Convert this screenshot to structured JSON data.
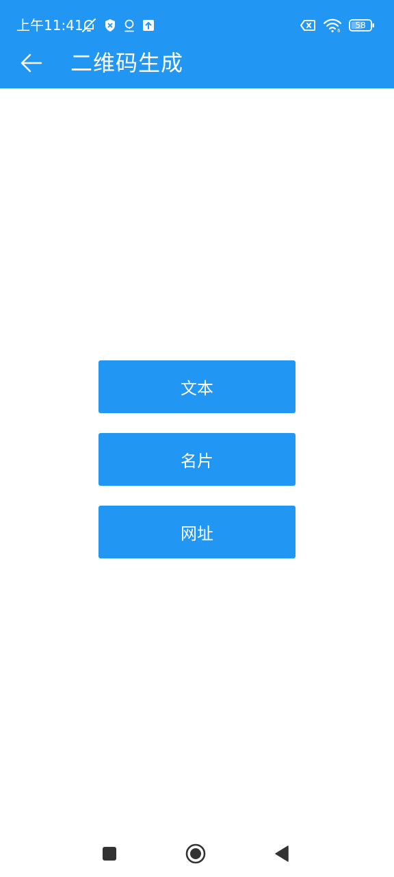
{
  "status_bar": {
    "time": "上午11:41",
    "battery_level": "58",
    "icons_left": [
      "notifications-off-icon",
      "shield-icon",
      "location-icon",
      "upload-icon"
    ],
    "icons_right": [
      "sim-error-icon",
      "wifi-icon",
      "battery-icon"
    ]
  },
  "app_bar": {
    "title": "二维码生成",
    "back_icon": "arrow-left-icon"
  },
  "menu": {
    "items": [
      {
        "label": "文本"
      },
      {
        "label": "名片"
      },
      {
        "label": "网址"
      }
    ]
  },
  "nav_bar": {
    "items": [
      "recents-icon",
      "home-icon",
      "back-icon"
    ]
  },
  "colors": {
    "primary": "#2196F3",
    "on_primary": "#FFFFFF",
    "background": "#FFFFFF",
    "nav_icon": "#333333"
  }
}
